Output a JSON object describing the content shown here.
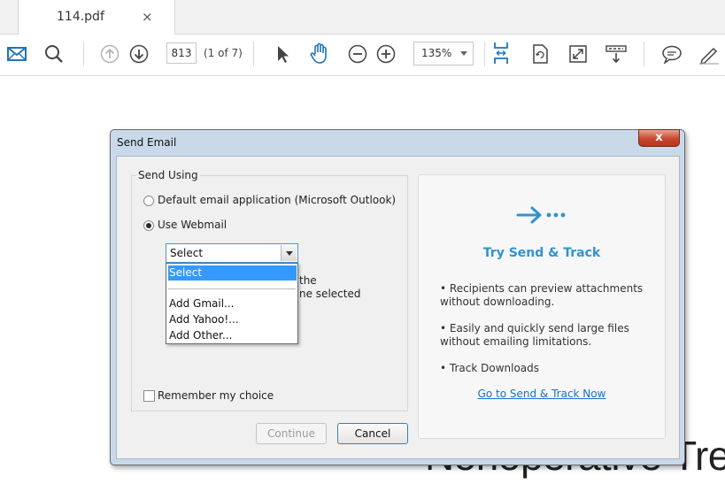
{
  "tab": {
    "title": "114.pdf",
    "close": "×"
  },
  "toolbar": {
    "page_current": "813",
    "page_count": "(1 of 7)",
    "zoom": "135%",
    "icons": [
      "mail-icon",
      "search-icon",
      "prev-page-icon",
      "next-page-icon",
      "select-cursor-icon",
      "hand-tool-icon",
      "zoom-out-icon",
      "zoom-in-icon",
      "fit-page-icon",
      "rotate-icon",
      "fullscreen-icon",
      "scroll-mode-icon",
      "comment-icon",
      "sign-icon"
    ],
    "accent": "#1c75bc"
  },
  "document": {
    "heading_fragment": "Nonoperative Tre"
  },
  "dialog": {
    "title": "Send Email",
    "close": "x",
    "group_label": "Send Using",
    "option_default": "Default email application (Microsoft Outlook)",
    "option_webmail": "Use Webmail",
    "selected_option": "webmail",
    "select": {
      "value": "Select",
      "options": [
        "Select",
        "",
        "Add Gmail...",
        "Add Yahoo!...",
        "Add Other..."
      ]
    },
    "partial_text_1": "the",
    "partial_text_2": "ne selected",
    "remember_label": "Remember my choice",
    "continue_label": "Continue",
    "cancel_label": "Cancel",
    "panel": {
      "title": "Try Send & Track",
      "bullets": [
        "• Recipients can preview attachments without downloading.",
        "• Easily and quickly send large files without emailing limitations.",
        "• Track Downloads"
      ],
      "link": "Go to Send & Track Now",
      "accent": "#2f93d2"
    }
  }
}
